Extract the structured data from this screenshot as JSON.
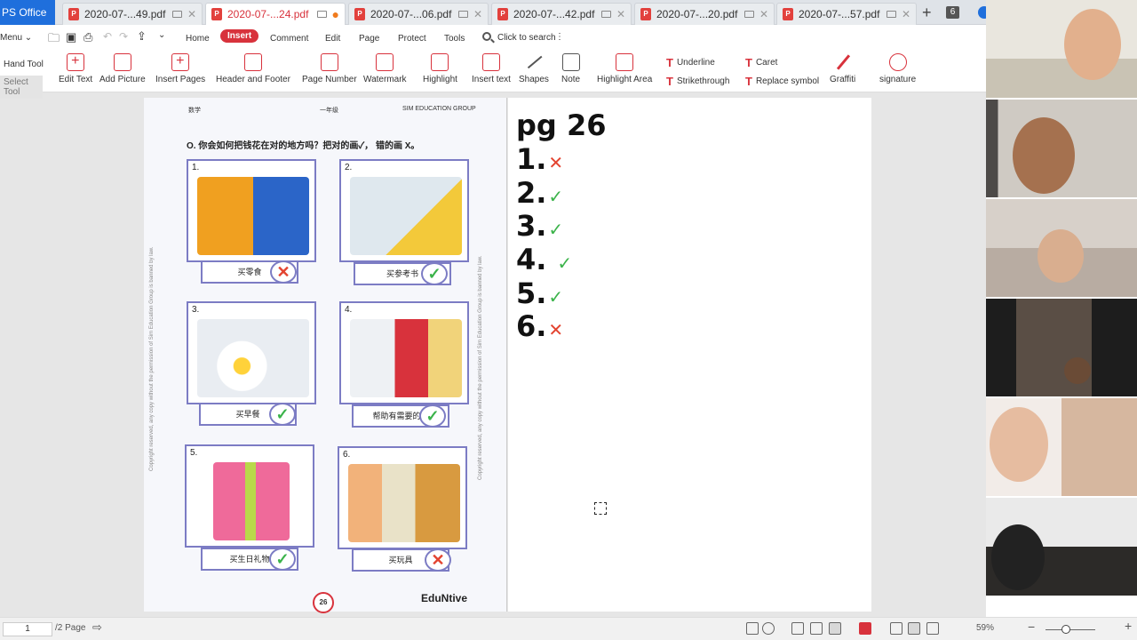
{
  "app": {
    "brand": "PS Office"
  },
  "tabs": [
    {
      "label": "2020-07-...49.pdf *",
      "active": false
    },
    {
      "label": "2020-07-...24.pdf *",
      "active": true
    },
    {
      "label": "2020-07-...06.pdf *",
      "active": false
    },
    {
      "label": "2020-07-...42.pdf *",
      "active": false
    },
    {
      "label": "2020-07-...20.pdf *",
      "active": false
    },
    {
      "label": "2020-07-...57.pdf *",
      "active": false
    }
  ],
  "tab_count": "6",
  "menu": {
    "menu_label": "Menu",
    "items": [
      "Home",
      "Insert",
      "Comment",
      "Edit",
      "Page",
      "Protect",
      "Tools"
    ],
    "search": "Click to search"
  },
  "toolbar": {
    "hand_tool": "Hand Tool",
    "select_tool": "Select Tool",
    "tools": [
      "Edit Text",
      "Add Picture",
      "Insert Pages",
      "Header and Footer",
      "Page Number",
      "Watermark",
      "Highlight",
      "Insert text",
      "Shapes",
      "Note",
      "Highlight Area",
      "Graffiti",
      "signature"
    ],
    "small_tools": {
      "underline": "Underline",
      "strikethrough": "Strikethrough",
      "caret": "Caret",
      "replace": "Replace symbol"
    }
  },
  "worksheet": {
    "header_left": "数学",
    "header_mid": "一年级",
    "header_right": "SIM EDUCATION GROUP",
    "question": "O. 你会如何把钱花在对的地方吗？把对的画✓， 错的画 X。",
    "items": [
      {
        "num": "1.",
        "label": "买零食",
        "mark": "✕"
      },
      {
        "num": "2.",
        "label": "买参考书",
        "mark": "✓"
      },
      {
        "num": "3.",
        "label": "买早餐",
        "mark": "✓"
      },
      {
        "num": "4.",
        "label": "帮助有需要的人",
        "mark": "✓"
      },
      {
        "num": "5.",
        "label": "买生日礼物",
        "mark": "✓"
      },
      {
        "num": "6.",
        "label": "买玩具",
        "mark": "✕"
      }
    ],
    "copyright": "Copyright reserved, any copy without the permission of Sim Education Group is banned by law.",
    "page_number": "26",
    "logo": "EduNtive"
  },
  "answers": {
    "title": "pg 26",
    "lines": [
      {
        "num": "1.",
        "sym": "✕",
        "kind": "x"
      },
      {
        "num": "2.",
        "sym": "✓",
        "kind": "t"
      },
      {
        "num": "3.",
        "sym": "✓",
        "kind": "t"
      },
      {
        "num": "4.",
        "sym": "✓",
        "kind": "t"
      },
      {
        "num": "5.",
        "sym": "✓",
        "kind": "t"
      },
      {
        "num": "6.",
        "sym": "✕",
        "kind": "x"
      }
    ]
  },
  "status": {
    "page": "1",
    "page_total": "/2 Page",
    "zoom": "59%"
  },
  "colors": {
    "accent": "#d8323c",
    "cross": "#e3432f",
    "tick": "#3bb34a",
    "border": "#7c7cc4"
  }
}
